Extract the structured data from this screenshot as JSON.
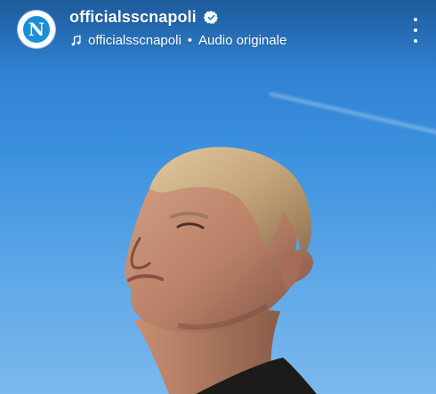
{
  "header": {
    "username": "officialsscnapoli",
    "audio_artist": "officialsscnapoli",
    "audio_separator": "•",
    "audio_title": "Audio originale",
    "avatar_letter": "N"
  },
  "icons": {
    "verified": "verified-badge-icon",
    "music": "music-note-icon",
    "more": "more-vertical-icon"
  },
  "colors": {
    "sky_top": "#2675c7",
    "sky_bottom": "#7bb8ed",
    "avatar_blue": "#1a8fd8",
    "text": "#ffffff"
  }
}
